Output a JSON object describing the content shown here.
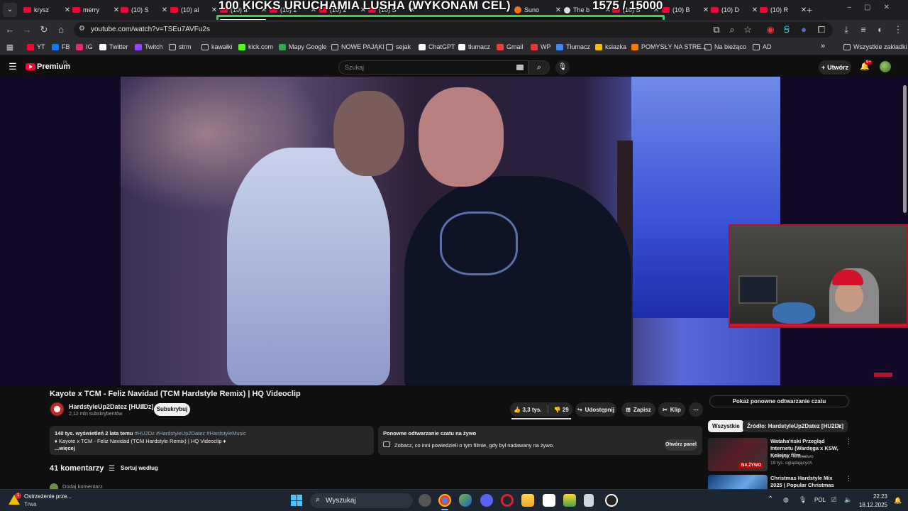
{
  "browser": {
    "tabs": [
      {
        "label": "krysz",
        "icon": "youtube-icon"
      },
      {
        "label": "merry",
        "icon": "youtube-icon"
      },
      {
        "label": "(10) S",
        "icon": "youtube-icon"
      },
      {
        "label": "(10) al",
        "icon": "youtube-icon"
      },
      {
        "label": "(10) a",
        "icon": "youtube-icon"
      },
      {
        "label": "(10) 2",
        "icon": "youtube-icon"
      },
      {
        "label": "(10) 2",
        "icon": "youtube-icon"
      },
      {
        "label": "(10) S",
        "icon": "youtube-icon"
      },
      {
        "label": "Suno",
        "icon": "suno-icon"
      },
      {
        "label": "The b",
        "icon": "dark-site-icon"
      },
      {
        "label": "(10) S",
        "icon": "youtube-icon"
      },
      {
        "label": "(10) B",
        "icon": "youtube-icon"
      },
      {
        "label": "(10) D",
        "icon": "youtube-icon"
      },
      {
        "label": "(10) R",
        "icon": "youtube-icon"
      }
    ],
    "url": "youtube.com/watch?v=TSEu7AVFu2s",
    "bookmarks": [
      {
        "label": "YT"
      },
      {
        "label": "FB"
      },
      {
        "label": "IG"
      },
      {
        "label": "Twitter"
      },
      {
        "label": "Twitch"
      },
      {
        "label": "strm"
      },
      {
        "label": "kawałki"
      },
      {
        "label": "kick.com"
      },
      {
        "label": "Mapy Google"
      },
      {
        "label": "NOWE PAJĄKI"
      },
      {
        "label": "sejak"
      },
      {
        "label": "ChatGPT"
      },
      {
        "label": "tłumacz"
      },
      {
        "label": "Gmail"
      },
      {
        "label": "WP"
      },
      {
        "label": "Tłumacz"
      },
      {
        "label": "ksiazka"
      },
      {
        "label": "POMYSŁY NA STRE..."
      },
      {
        "label": "Na bieżąco"
      },
      {
        "label": "AD"
      }
    ],
    "all_bookmarks": "Wszystkie zakładki"
  },
  "overlay": {
    "title": "100 KICKS URUCHAMIA LUSHA (WYKONAM CEL)",
    "current": "1575",
    "goal": "/ 15000",
    "progress": 0.105
  },
  "youtube": {
    "logo": "Premium",
    "region": "PL",
    "search_placeholder": "Szukaj",
    "create_label": "Utwórz",
    "notifications": "9+",
    "video": {
      "title": "Kayote x TCM - Feliz Navidad (TCM Hardstyle Remix) | HQ Videoclip",
      "channel": "HardstyleUp2Datez [HU2Dz]",
      "subscribers": "2,12 mln subskrybentów",
      "subscribe_label": "Subskrybuj",
      "likes": "3,3 tys.",
      "dislikes": "29",
      "share": "Udostępnij",
      "save": "Zapisz",
      "clip": "Klip"
    },
    "description": {
      "meta": "140 tys. wyświetleń  2 lata temu",
      "tags": "#HU2Dz #HardstyleUp2Datez #HardstyleMusic",
      "line2": "♦ Kayote x TCM - Feliz Navidad (TCM Hardstyle Remix) | HQ Videoclip ♦",
      "more": "...więcej"
    },
    "chat_replay": {
      "title": "Ponowne odtwarzanie czatu na żywo",
      "text": "Zobacz, co inni powiedzieli o tym filmie, gdy był nadawany na żywo.",
      "open_button": "Otwórz panel"
    },
    "comments": {
      "count": "41 komentarzy",
      "sort": "Sortuj według",
      "add": "Dodaj komentarz"
    },
    "sidebar": {
      "show_chat": "Pokaż ponowne odtwarzanie czatu",
      "chips": [
        "Wszystkie",
        "Źródło: HardstyleUp2Datez [HU2Dz]"
      ],
      "recommendations": [
        {
          "title": "Wataha'ński Przegląd Internetu (Wardęga x KSW, Kolejny film ...",
          "channel": "WATAHA · Królestwo",
          "meta": "19 tys. oglądających",
          "badge": "NA ŻYWO"
        },
        {
          "title": "Christmas Hardstyle Mix 2025 | Popular Christmas Songs",
          "channel": "",
          "meta": "",
          "badge": ""
        }
      ]
    }
  },
  "taskbar": {
    "warning_title": "Ostrzeżenie prze...",
    "warning_sub": "Trwa",
    "warning_count": "1",
    "search_label": "Wyszukaj",
    "lang": "POL",
    "time": "22:23",
    "date": "18.12.2025"
  },
  "colors": {
    "youtube_red": "#ff0033",
    "overlay_green": "#39d353",
    "background": "#0f0f0f"
  }
}
